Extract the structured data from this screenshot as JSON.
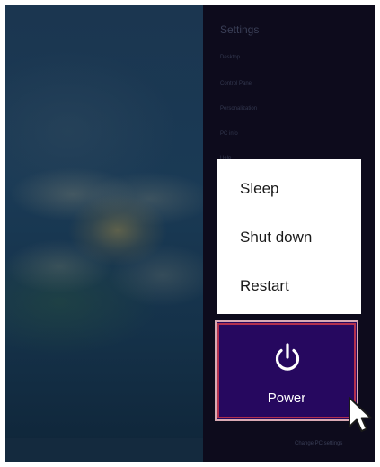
{
  "charm": {
    "title": "Settings",
    "items": [
      {
        "label": "Desktop"
      },
      {
        "label": "Control Panel"
      },
      {
        "label": "Personalization"
      },
      {
        "label": "PC info"
      },
      {
        "label": "Help"
      }
    ],
    "change_settings_label": "Change PC settings"
  },
  "power_menu": {
    "items": [
      {
        "label": "Sleep"
      },
      {
        "label": "Shut down"
      },
      {
        "label": "Restart"
      }
    ]
  },
  "power_button": {
    "label": "Power",
    "icon": "power-icon",
    "background_color": "#26085f",
    "highlight_color": "#b3304e"
  },
  "cursor": {
    "icon": "mouse-pointer-icon"
  }
}
